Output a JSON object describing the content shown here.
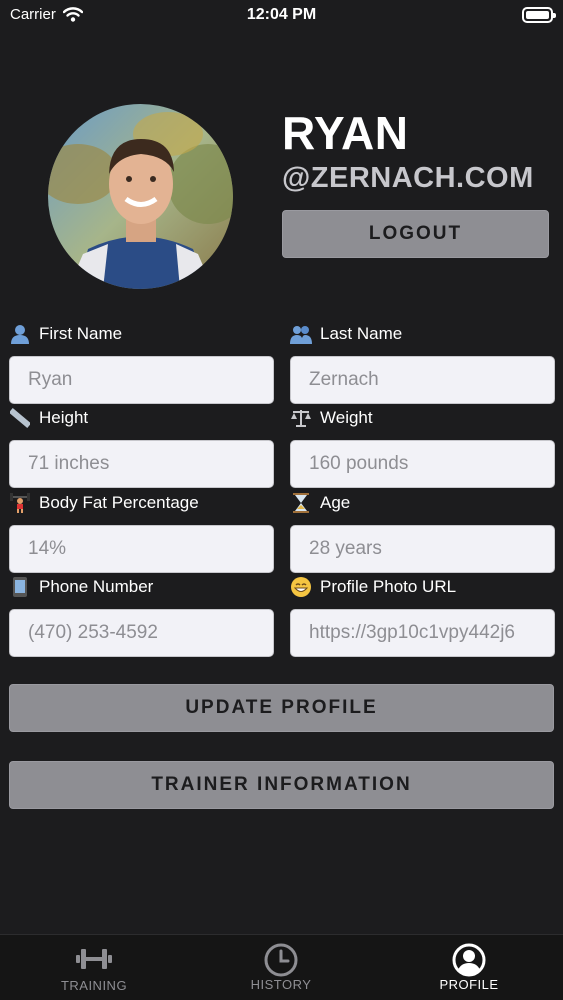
{
  "status_bar": {
    "carrier": "Carrier",
    "time": "12:04 PM",
    "icons": [
      "wifi-icon",
      "battery-icon"
    ]
  },
  "profile": {
    "name": "RYAN",
    "domain": "@ZERNACH.COM",
    "logout_label": "LOGOUT"
  },
  "fields": {
    "first_name": {
      "label": "First Name",
      "icon": "person-icon",
      "value": "Ryan"
    },
    "last_name": {
      "label": "Last Name",
      "icon": "people-icon",
      "value": "Zernach"
    },
    "height": {
      "label": "Height",
      "icon": "ruler-icon",
      "value": "71 inches"
    },
    "weight": {
      "label": "Weight",
      "icon": "scales-icon",
      "value": "160 pounds"
    },
    "body_fat": {
      "label": "Body Fat Percentage",
      "icon": "weightlifter-icon",
      "value": "14%"
    },
    "age": {
      "label": "Age",
      "icon": "hourglass-icon",
      "value": "28 years"
    },
    "phone": {
      "label": "Phone Number",
      "icon": "mobile-phone-icon",
      "value": "(470) 253-4592"
    },
    "photo_url": {
      "label": "Profile Photo URL",
      "icon": "grinning-face-icon",
      "value": "https://3gp10c1vpy442j6"
    }
  },
  "actions": {
    "update_label": "UPDATE PROFILE",
    "trainer_label": "TRAINER INFORMATION"
  },
  "tab_bar": {
    "tabs": [
      {
        "label": "TRAINING",
        "icon": "dumbbell-icon",
        "active": false
      },
      {
        "label": "HISTORY",
        "icon": "clock-icon",
        "active": false
      },
      {
        "label": "PROFILE",
        "icon": "user-circle-icon",
        "active": true
      }
    ]
  },
  "colors": {
    "background": "#1c1c1e",
    "button": "#8e8e93",
    "input_background": "#f2f2f7",
    "tab_active": "#ffffff",
    "tab_inactive": "#8e8e93"
  }
}
